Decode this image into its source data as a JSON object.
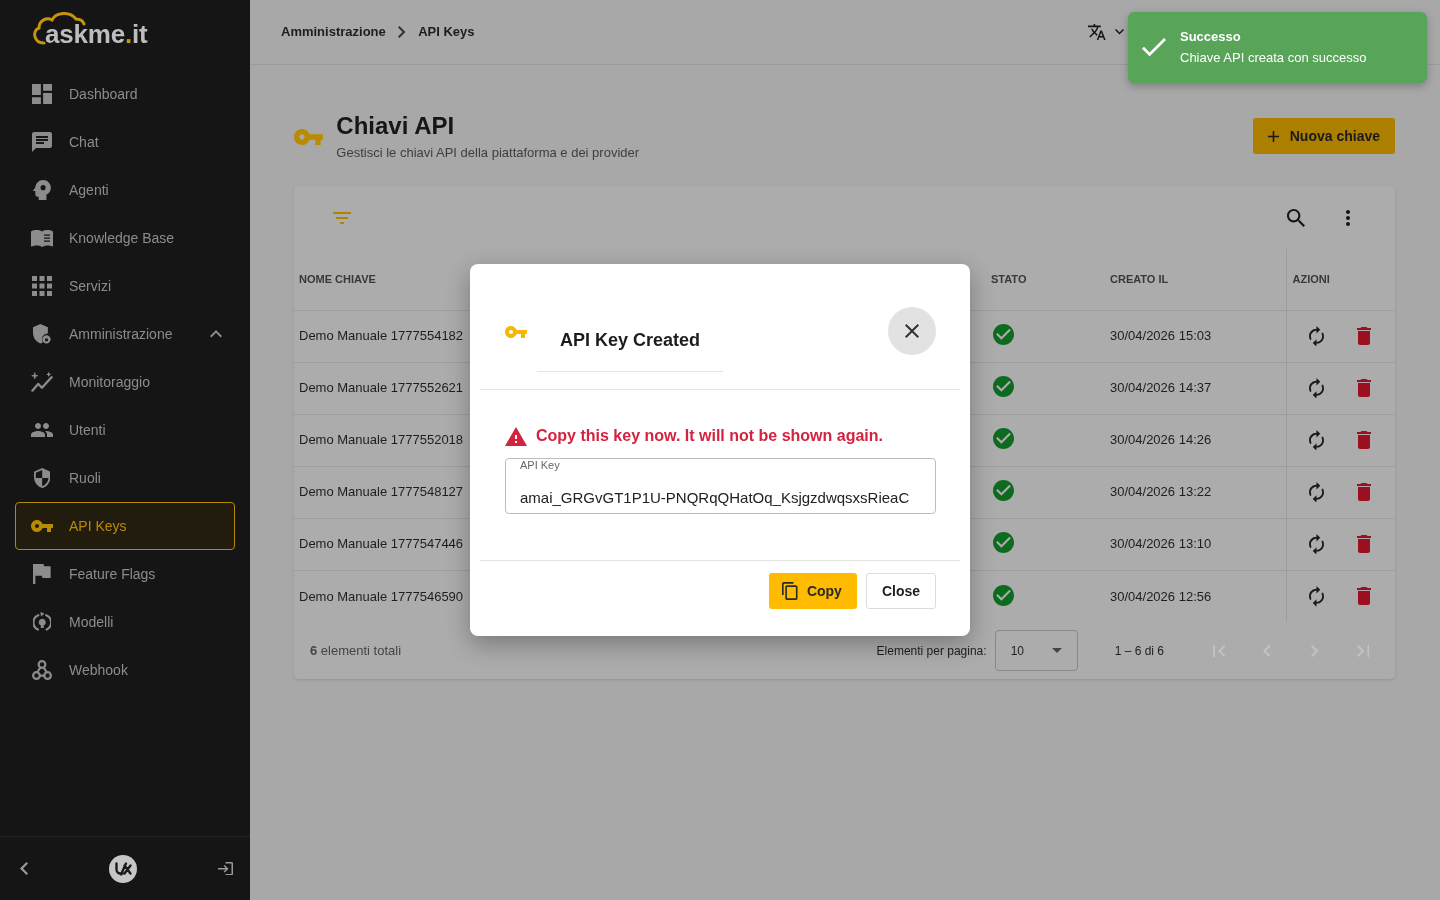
{
  "sidebar": {
    "logo": {
      "parts": [
        {
          "text": "askme",
          "accent": false
        },
        {
          "text": ".",
          "accent": true
        },
        {
          "text": "it",
          "accent": false
        }
      ]
    },
    "items": [
      {
        "label": "Dashboard",
        "selected": false
      },
      {
        "label": "Chat",
        "selected": false
      },
      {
        "label": "Agenti",
        "selected": false
      },
      {
        "label": "Knowledge Base",
        "selected": false
      },
      {
        "label": "Servizi",
        "selected": false
      },
      {
        "label": "Amministrazione",
        "selected": false,
        "expanded": true,
        "children": [
          {
            "label": "Monitoraggio",
            "selected": false
          },
          {
            "label": "Utenti",
            "selected": false
          },
          {
            "label": "Ruoli",
            "selected": false
          },
          {
            "label": "API Keys",
            "selected": true
          },
          {
            "label": "Feature Flags",
            "selected": false
          },
          {
            "label": "Modelli",
            "selected": false
          },
          {
            "label": "Webhook",
            "selected": false
          }
        ]
      }
    ]
  },
  "topbar": {
    "breadcrumbs": [
      {
        "label": "Amministrazione"
      },
      {
        "label": "API Keys"
      }
    ]
  },
  "page": {
    "title": "Chiavi API",
    "subtitle": "Gestisci le chiavi API della piattaforma e dei provider",
    "new_button": "Nuova chiave"
  },
  "table": {
    "columns": [
      {
        "label": "NOME CHIAVE"
      },
      {
        "label": "STATO"
      },
      {
        "label": "CREATO IL"
      },
      {
        "label": "AZIONI"
      }
    ],
    "rows": [
      {
        "name": "Demo Manuale 1777554182",
        "active": true,
        "created": "30/04/2026 15:03"
      },
      {
        "name": "Demo Manuale 1777552621",
        "active": true,
        "created": "30/04/2026 14:37"
      },
      {
        "name": "Demo Manuale 1777552018",
        "active": true,
        "created": "30/04/2026 14:26"
      },
      {
        "name": "Demo Manuale 1777548127",
        "active": true,
        "created": "30/04/2026 13:22"
      },
      {
        "name": "Demo Manuale 1777547446",
        "active": true,
        "created": "30/04/2026 13:10"
      },
      {
        "name": "Demo Manuale 1777546590",
        "active": true,
        "created": "30/04/2026 12:56"
      }
    ],
    "footer": {
      "total": "**6** elementi totali",
      "per_page_label": "Elementi per pagina:",
      "per_page": "10",
      "range": "1 – 6 di 6",
      "pager": [
        {
          "kind": "first",
          "disabled": true
        },
        {
          "kind": "prev",
          "disabled": true
        },
        {
          "kind": "next",
          "disabled": true
        },
        {
          "kind": "last",
          "disabled": true
        }
      ]
    }
  },
  "dialog": {
    "title": "API Key Created",
    "warning": "Copy this key now. It will not be shown again.",
    "field": {
      "label": "API Key",
      "value": "amai_GRGvGT1P1U-PNQRqQHatOq_KsjgzdwqsxsRieaC"
    },
    "buttons": [
      {
        "label": "Copy",
        "kind": "primary"
      },
      {
        "label": "Close",
        "kind": "secondary"
      }
    ]
  },
  "toast": {
    "title": "Successo",
    "message": "Chiave API creata con successo"
  }
}
